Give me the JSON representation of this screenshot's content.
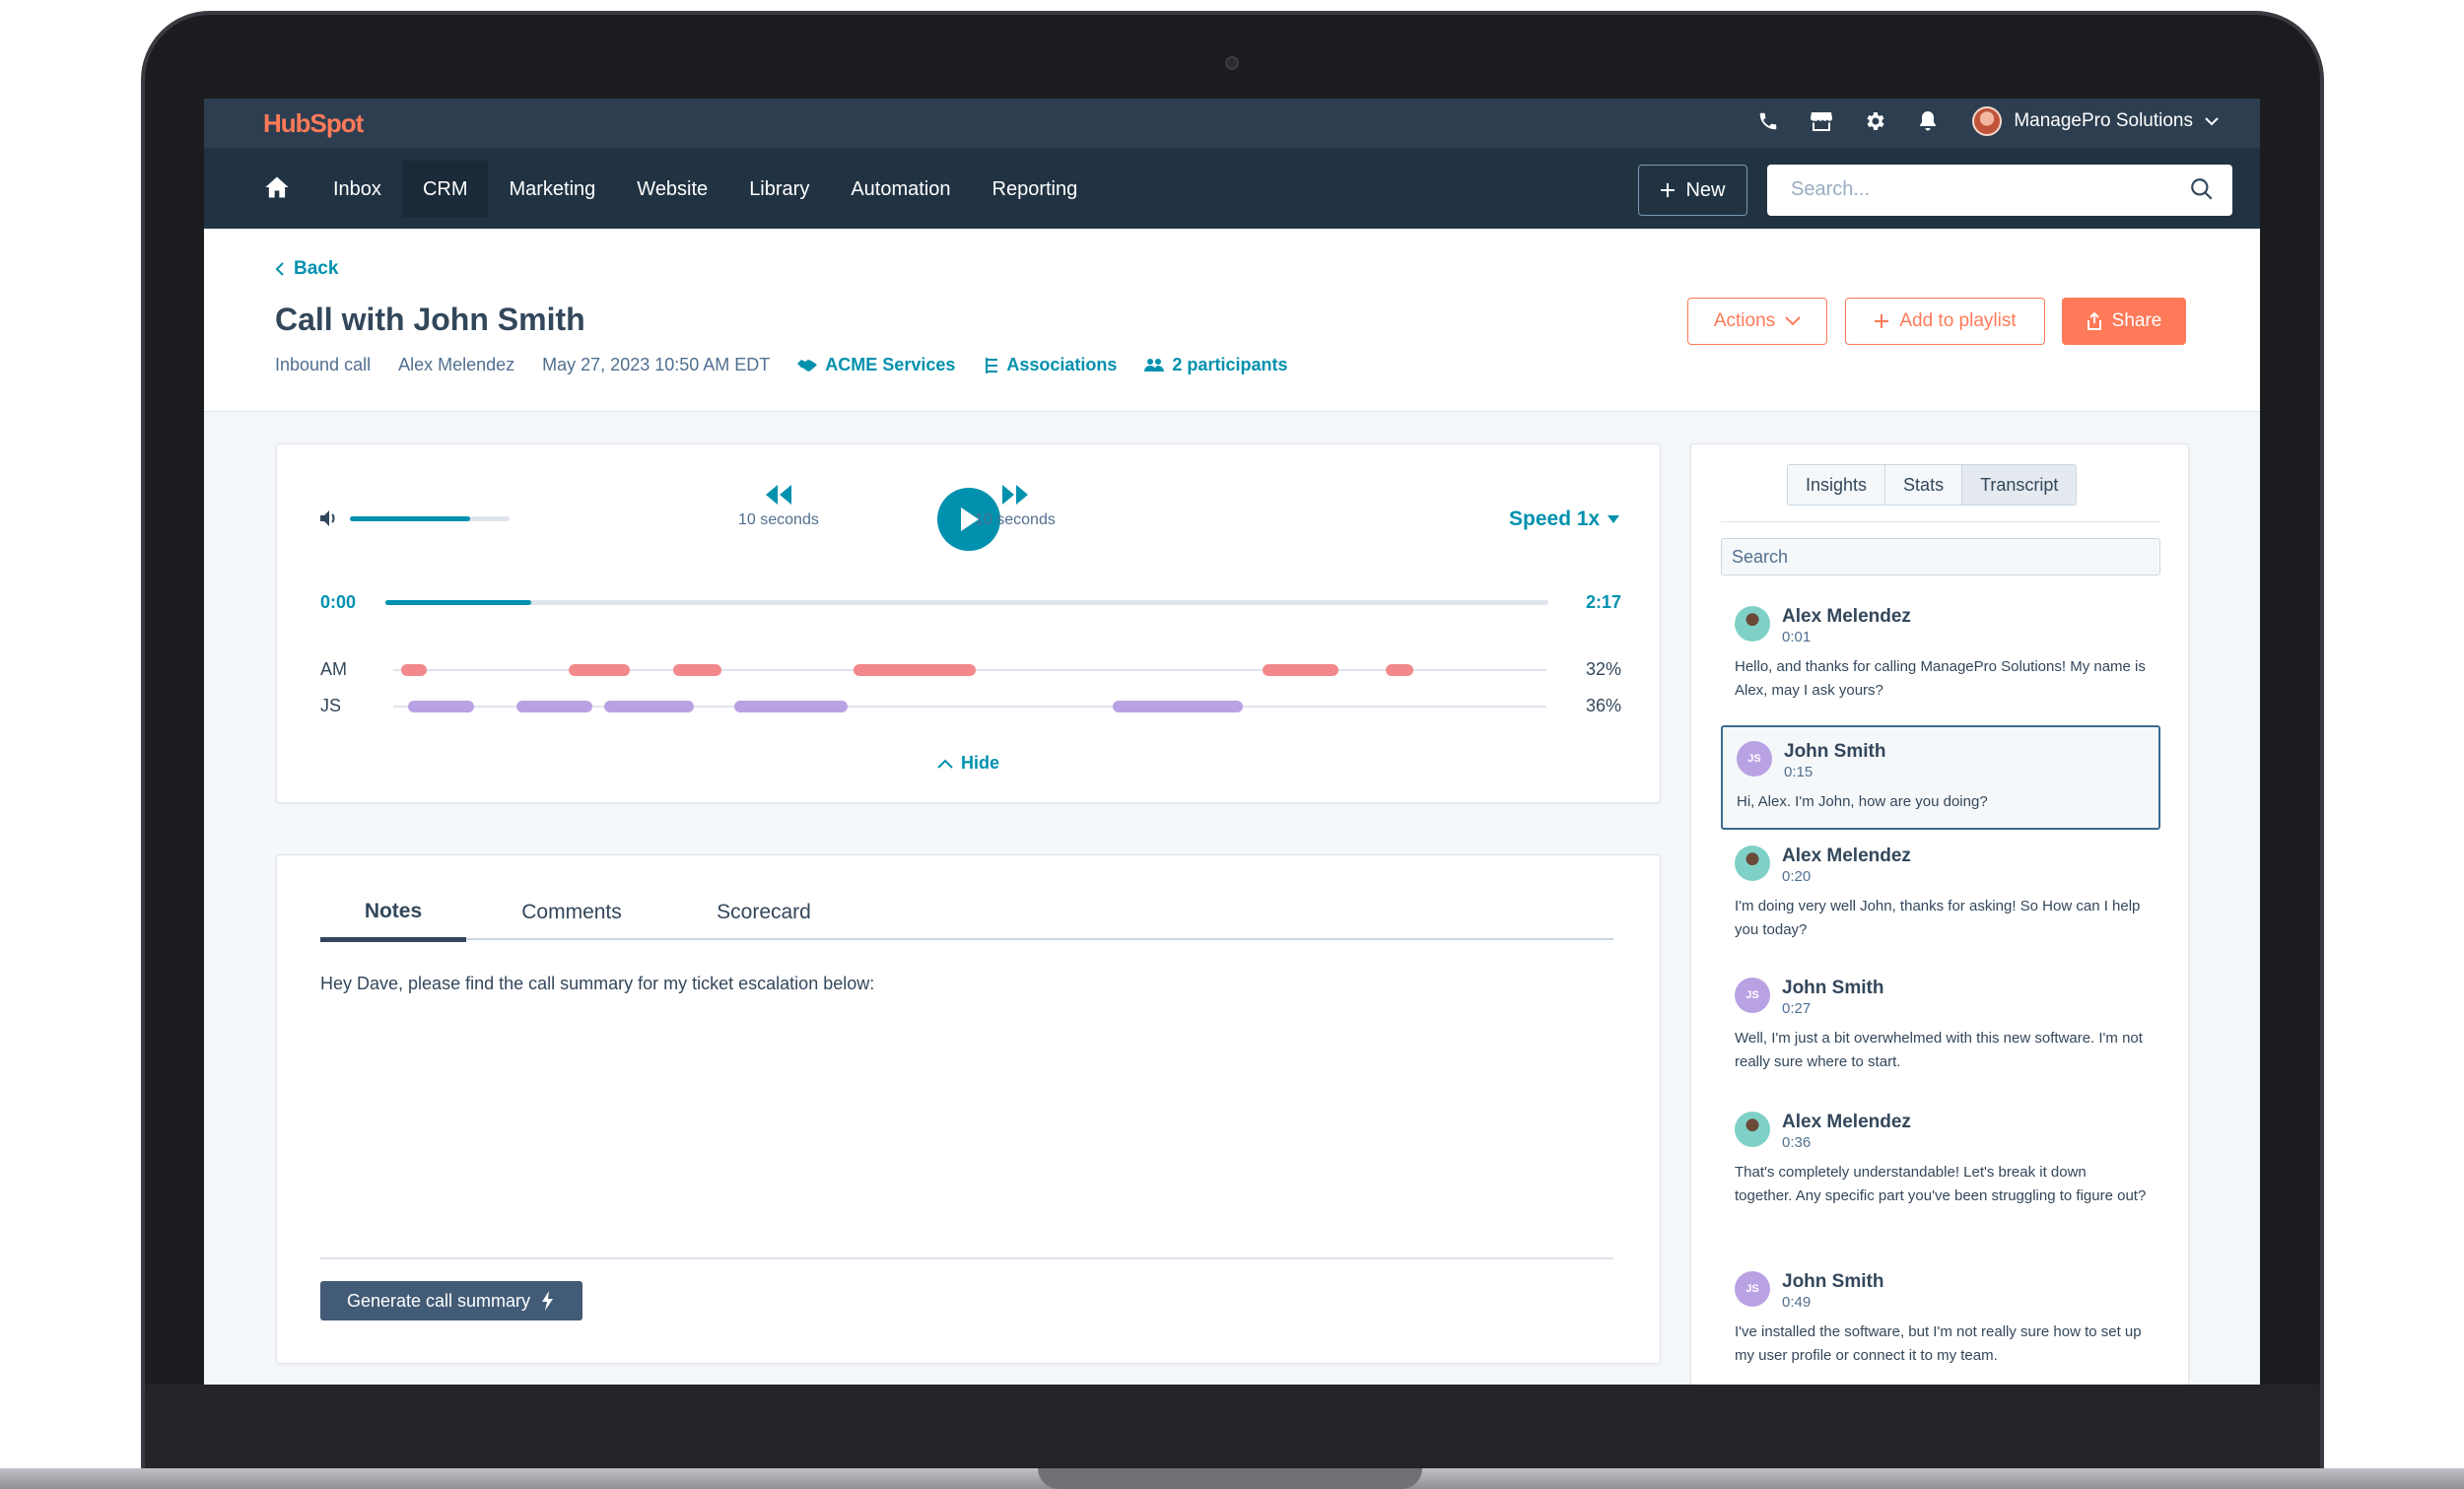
{
  "topbar": {
    "logo": "HubSpot",
    "icons": [
      "phone-icon",
      "marketplace-icon",
      "gear-icon",
      "bell-icon"
    ],
    "account_name": "ManagePro Solutions"
  },
  "nav": {
    "items": [
      "Inbox",
      "CRM",
      "Marketing",
      "Website",
      "Library",
      "Automation",
      "Reporting"
    ],
    "active": "CRM",
    "new_label": "New",
    "search_placeholder": "Search..."
  },
  "header": {
    "back_label": "Back",
    "title": "Call with John Smith",
    "call_type": "Inbound call",
    "owner": "Alex Melendez",
    "datetime": "May 27, 2023 10:50 AM EDT",
    "company": "ACME Services",
    "associations": "Associations",
    "participants": "2 participants",
    "actions_label": "Actions",
    "playlist_label": "Add to playlist",
    "share_label": "Share"
  },
  "player": {
    "volume_level": 0.75,
    "rewind_label": "10 seconds",
    "forward_label": "10 seconds",
    "speed_label": "Speed 1x",
    "current_time": "0:00",
    "duration": "2:17",
    "progress": 0.125,
    "speakers": [
      {
        "label": "AM",
        "percent": "32%",
        "color": "#f2888b",
        "segments": [
          [
            0.007,
            0.029
          ],
          [
            0.152,
            0.205
          ],
          [
            0.243,
            0.285
          ],
          [
            0.399,
            0.505
          ],
          [
            0.754,
            0.82
          ],
          [
            0.861,
            0.885
          ]
        ]
      },
      {
        "label": "JS",
        "percent": "36%",
        "color": "#b9a2e3",
        "segments": [
          [
            0.013,
            0.07
          ],
          [
            0.107,
            0.173
          ],
          [
            0.183,
            0.261
          ],
          [
            0.296,
            0.394
          ],
          [
            0.624,
            0.737
          ]
        ]
      }
    ],
    "hide_label": "Hide"
  },
  "notes": {
    "tabs": [
      "Notes",
      "Comments",
      "Scorecard"
    ],
    "active_tab": "Notes",
    "body": "Hey Dave, please find the call summary for my ticket escalation below:",
    "generate_label": "Generate call summary"
  },
  "transcript": {
    "tabs": [
      "Insights",
      "Stats",
      "Transcript"
    ],
    "active_tab": "Transcript",
    "search_placeholder": "Search",
    "entries": [
      {
        "speaker": "Alex Melendez",
        "initials": "",
        "time": "0:01",
        "text": "Hello, and thanks for calling ManagePro Solutions! My name is Alex, may I ask yours?"
      },
      {
        "speaker": "John Smith",
        "initials": "JS",
        "time": "0:15",
        "text": "Hi, Alex. I'm John, how are you doing?"
      },
      {
        "speaker": "Alex Melendez",
        "initials": "",
        "time": "0:20",
        "text": "I'm doing very well John, thanks for asking! So How can I help you today?"
      },
      {
        "speaker": "John Smith",
        "initials": "JS",
        "time": "0:27",
        "text": "Well, I'm just a bit overwhelmed with this new software. I'm not really sure where to start."
      },
      {
        "speaker": "Alex Melendez",
        "initials": "",
        "time": "0:36",
        "text": "That's completely understandable! Let's break it down together. Any specific part you've been struggling to figure out?"
      },
      {
        "speaker": "John Smith",
        "initials": "JS",
        "time": "0:49",
        "text": "I've installed the software, but I'm not really sure how to set up my user profile or connect it to my team."
      }
    ]
  }
}
